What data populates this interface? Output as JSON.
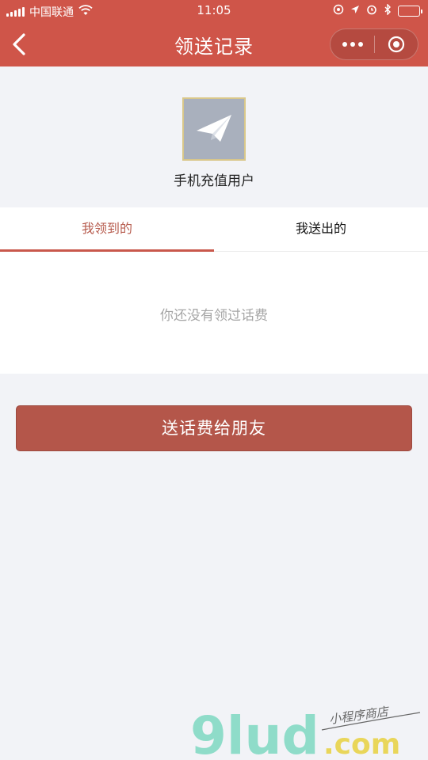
{
  "status_bar": {
    "carrier": "中国联通",
    "time": "11:05",
    "battery_level": 0.6
  },
  "nav": {
    "title": "领送记录"
  },
  "profile": {
    "name": "手机充值用户"
  },
  "tabs": [
    {
      "label": "我领到的",
      "active": true
    },
    {
      "label": "我送出的",
      "active": false
    }
  ],
  "empty_state": {
    "message": "你还没有领过话费"
  },
  "actions": {
    "send_label": "送话费给朋友"
  },
  "watermark": {
    "brand": "9lud",
    "domain": ".com",
    "slogan": "小程序商店"
  },
  "colors": {
    "primary": "#cf5549",
    "button": "#b4564a",
    "tab_active_text": "#b65a4c"
  }
}
